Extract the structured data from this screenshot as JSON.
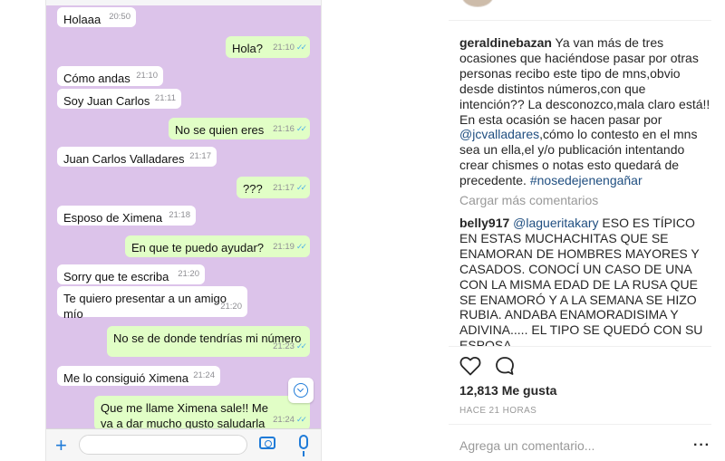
{
  "chat": {
    "messages": [
      {
        "text": "Holaaa",
        "time": "20:50",
        "dir": "in"
      },
      {
        "text": "Hola?",
        "time": "21:10",
        "dir": "out"
      },
      {
        "text": "Cómo andas",
        "time": "21:10",
        "dir": "in"
      },
      {
        "text": "Soy Juan Carlos",
        "time": "21:11",
        "dir": "in"
      },
      {
        "text": "No se quien eres",
        "time": "21:16",
        "dir": "out"
      },
      {
        "text": "Juan Carlos Valladares",
        "time": "21:17",
        "dir": "in"
      },
      {
        "text": "???",
        "time": "21:17",
        "dir": "out"
      },
      {
        "text": "Esposo de Ximena",
        "time": "21:18",
        "dir": "in"
      },
      {
        "text": "En que te puedo ayudar?",
        "time": "21:19",
        "dir": "out"
      },
      {
        "text": "Sorry que te escriba",
        "time": "21:20",
        "dir": "in"
      },
      {
        "text": "Te quiero presentar a un amigo mío",
        "time": "21:20",
        "dir": "in"
      },
      {
        "text": "No se de donde tendrías  mi número",
        "time": "21:23",
        "dir": "out"
      },
      {
        "text": "Me lo consiguió Ximena",
        "time": "21:24",
        "dir": "in"
      },
      {
        "text": "Que me llame Ximena sale!! Me va a dar mucho gusto saludarla",
        "time": "21:24",
        "dir": "out"
      }
    ],
    "tick_glyph": "✓✓",
    "icons": {
      "add": "plus-icon",
      "camera": "camera-icon",
      "mic": "microphone-icon",
      "scroll": "chevron-down-circle-icon"
    }
  },
  "post": {
    "caption": {
      "username": "geraldinebazan",
      "text_1": " Ya van más de tres ocasiones que haciéndose pasar por otras personas recibo este tipo de mns,obvio desde distintos números,con que intención?? La desconozco,mala claro está!! En esta ocasión se hacen pasar por ",
      "mention": "@jcvalladares",
      "text_2": ",cómo lo contesto en el mns sea un ella,el y/o publicación intentando crear chismes o notas esto quedará de precedente. ",
      "hashtag": "#nosedejenengañar"
    },
    "load_more": "Cargar más comentarios",
    "comment": {
      "username": "belly917",
      "mention": "@lagueritakary",
      "text": " ESO ES TÍPICO EN ESTAS MUCHACHITAS QUE SE ENAMORAN DE HOMBRES MAYORES Y CASADOS. CONOCÍ UN CASO DE UNA CON LA MISMA EDAD DE LA RUSA QUE SE ENAMORÓ Y A LA SEMANA SE HIZO RUBIA. ANDABA ENAMORADISIMA Y ADIVINA..... EL TIPO SE QUEDÓ CON SU ESPOSA"
    },
    "likes": "12,813 Me gusta",
    "time_ago": "HACE 21 HORAS",
    "add_comment_placeholder": "Agrega un comentario...",
    "more": "···",
    "colors": {
      "link": "#1f4e80",
      "muted": "#999999",
      "text": "#262626"
    },
    "icons": {
      "like": "heart-icon",
      "comment": "speech-bubble-icon",
      "options": "ellipsis-icon"
    }
  }
}
